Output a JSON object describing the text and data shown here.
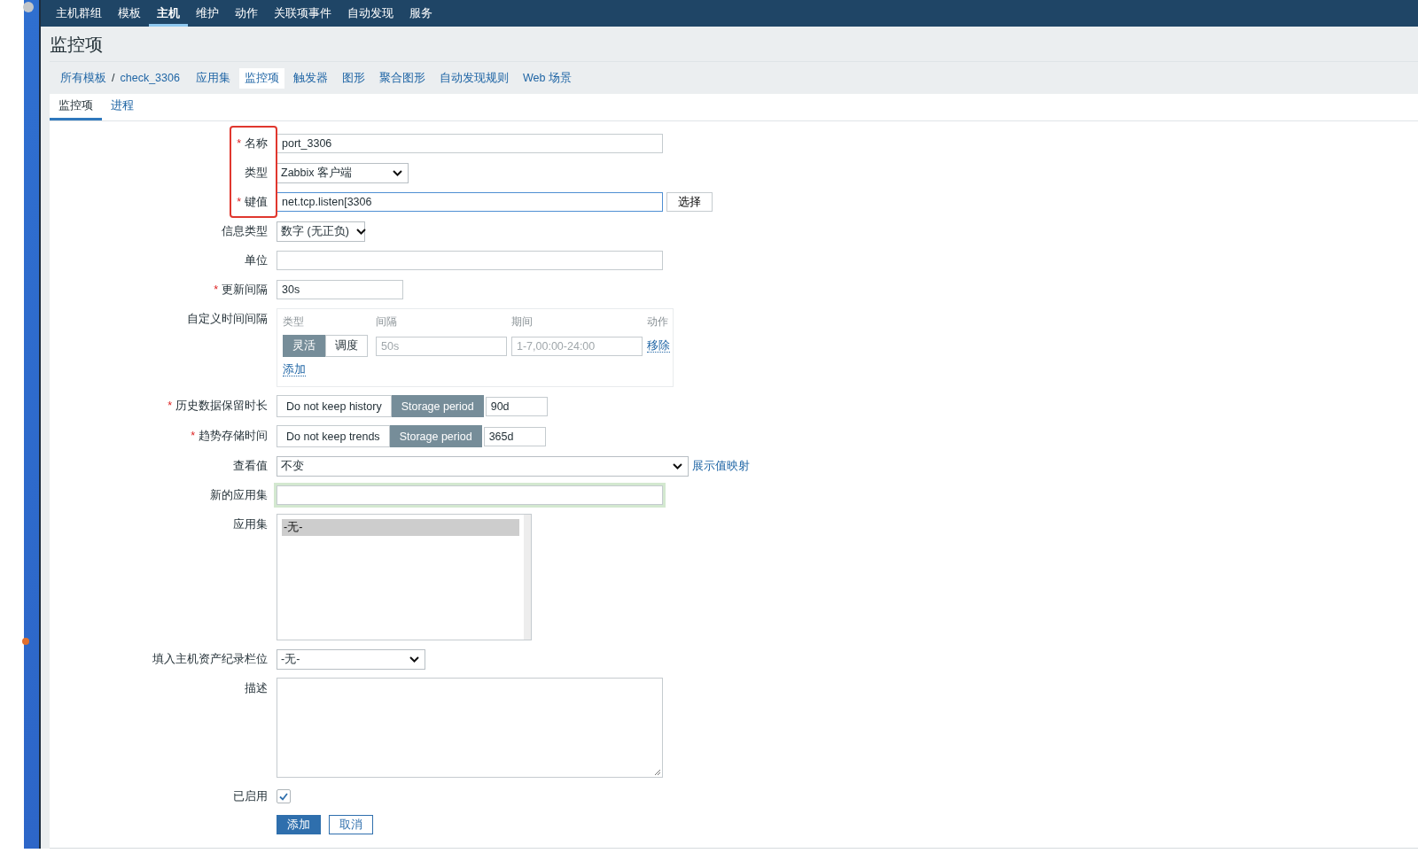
{
  "nav": [
    {
      "label": "主机群组",
      "selected": false
    },
    {
      "label": "模板",
      "selected": false
    },
    {
      "label": "主机",
      "selected": true
    },
    {
      "label": "维护",
      "selected": false
    },
    {
      "label": "动作",
      "selected": false
    },
    {
      "label": "关联项事件",
      "selected": false
    },
    {
      "label": "自动发现",
      "selected": false
    },
    {
      "label": "服务",
      "selected": false
    }
  ],
  "page_title": "监控项",
  "breadcrumbs": {
    "path": [
      "所有模板",
      "check_3306"
    ],
    "separator": "/",
    "links": [
      {
        "label": "应用集",
        "selected": false
      },
      {
        "label": "监控项",
        "selected": true
      },
      {
        "label": "触发器",
        "selected": false
      },
      {
        "label": "图形",
        "selected": false
      },
      {
        "label": "聚合图形",
        "selected": false
      },
      {
        "label": "自动发现规则",
        "selected": false
      },
      {
        "label": "Web 场景",
        "selected": false
      }
    ]
  },
  "tabs": [
    {
      "label": "监控项",
      "selected": true
    },
    {
      "label": "进程",
      "selected": false
    }
  ],
  "form": {
    "rows": [
      {
        "kind": "text",
        "label": "名称",
        "marker": "*",
        "highlighted": true,
        "value": "port_3306",
        "focused": false
      },
      {
        "kind": "select",
        "label": "类型",
        "highlighted": true,
        "value": "Zabbix 客户端"
      },
      {
        "kind": "text",
        "label": "键值",
        "marker": "*",
        "highlighted": true,
        "value": "net.tcp.listen[3306",
        "focused": true,
        "button": "选择"
      },
      {
        "kind": "select",
        "label": "信息类型",
        "highlighted": false,
        "value": "数字 (无正负)"
      },
      {
        "kind": "text",
        "label": "单位",
        "highlighted": false,
        "value": "",
        "focused": false
      },
      {
        "kind": "text",
        "label": "更新间隔",
        "marker": "*",
        "highlighted": false,
        "value": "30s",
        "focused": false
      },
      {
        "kind": "intervals",
        "label": "自定义时间间隔",
        "highlighted": false,
        "columns": [
          "类型",
          "间隔",
          "期间",
          "动作"
        ],
        "entries": [
          {
            "options": [
              {
                "label": "灵活",
                "selected": true
              },
              {
                "label": "调度",
                "selected": false
              }
            ],
            "interval_placeholder": "50s",
            "period_placeholder": "1-7,00:00-24:00",
            "action": "移除"
          }
        ],
        "add": "添加"
      },
      {
        "kind": "storage",
        "label": "历史数据保留时长",
        "marker": "*",
        "highlighted": false,
        "options": [
          {
            "label": "Do not keep history",
            "selected": false
          },
          {
            "label": "Storage period",
            "selected": true
          }
        ],
        "value": "90d"
      },
      {
        "kind": "storage",
        "label": "趋势存储时间",
        "marker": "*",
        "highlighted": false,
        "options": [
          {
            "label": "Do not keep trends",
            "selected": false
          },
          {
            "label": "Storage period",
            "selected": true
          }
        ],
        "value": "365d"
      },
      {
        "kind": "select",
        "label": "查看值",
        "highlighted": false,
        "value": "不变",
        "link": "展示值映射"
      },
      {
        "kind": "text",
        "label": "新的应用集",
        "highlighted": false,
        "value": "",
        "focused": false,
        "glow": true
      },
      {
        "kind": "listbox",
        "label": "应用集",
        "highlighted": false,
        "items": [
          {
            "label": "-无-",
            "selected": true
          }
        ]
      },
      {
        "kind": "select",
        "label": "填入主机资产纪录栏位",
        "highlighted": false,
        "value": "-无-"
      },
      {
        "kind": "textarea",
        "label": "描述",
        "highlighted": false,
        "value": ""
      },
      {
        "kind": "checkbox",
        "label": "已启用",
        "highlighted": false,
        "checked": true
      }
    ],
    "buttons": [
      {
        "label": "添加",
        "kind": "primary"
      },
      {
        "label": "取消",
        "kind": "secondary"
      }
    ]
  }
}
